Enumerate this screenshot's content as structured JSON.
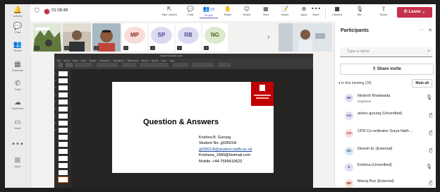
{
  "rail": [
    {
      "icon": "activity-icon",
      "glyph": "🔔",
      "label": "Activity"
    },
    {
      "icon": "chat-icon",
      "glyph": "💬",
      "label": "Chat"
    },
    {
      "icon": "teams-icon",
      "glyph": "👥",
      "label": "Teams"
    },
    {
      "icon": "calendar-icon",
      "glyph": "▦",
      "label": "Calendar"
    },
    {
      "icon": "calls-icon",
      "glyph": "✆",
      "label": "Calls"
    },
    {
      "icon": "onedrive-icon",
      "glyph": "☁",
      "label": "OneDrive"
    },
    {
      "icon": "meet-icon",
      "glyph": "▭",
      "label": "Meet"
    },
    {
      "icon": "more-icon",
      "glyph": "•••",
      "label": ""
    },
    {
      "icon": "apps-icon",
      "glyph": "⊞",
      "label": "Apps"
    }
  ],
  "meeting": {
    "timer": "01:08:48",
    "buttons": [
      {
        "name": "take-control",
        "icon": "⇱",
        "label": "Take control"
      },
      {
        "name": "chat",
        "icon": "💬",
        "label": "Chat"
      },
      {
        "name": "people",
        "icon": "👥",
        "label": "People",
        "count": "18"
      },
      {
        "name": "raise",
        "icon": "✋",
        "label": "Raise"
      },
      {
        "name": "react",
        "icon": "☺",
        "label": "React"
      },
      {
        "name": "view",
        "icon": "▦",
        "label": "View"
      },
      {
        "name": "notes",
        "icon": "📝",
        "label": "Notes"
      },
      {
        "name": "apps",
        "icon": "⊕",
        "label": "Apps"
      },
      {
        "name": "more",
        "icon": "•••",
        "label": "More"
      },
      {
        "name": "camera",
        "icon": "■",
        "label": "Camera"
      },
      {
        "name": "mic",
        "icon": "🎙",
        "label": "Mic"
      },
      {
        "name": "share",
        "icon": "⇧",
        "label": "Share"
      }
    ],
    "leave_label": "Leave"
  },
  "strip": {
    "avatars": [
      {
        "initials": "MP",
        "bg": "#f9dcd7",
        "fg": "#8e2b1f"
      },
      {
        "initials": "SP",
        "bg": "#dcd9f2",
        "fg": "#4f4596"
      },
      {
        "initials": "RB",
        "bg": "#dcdbf3",
        "fg": "#4e4b8f"
      },
      {
        "initials": "NG",
        "bg": "#dde8cf",
        "fg": "#4b6b1e"
      }
    ]
  },
  "slide": {
    "window_title": "Nepal Presentation.pptx",
    "ribbon_tabs": [
      "File",
      "Home",
      "Insert",
      "Draw",
      "Design",
      "Transitions",
      "Animations",
      "Slide Show",
      "Record",
      "Review",
      "View",
      "Help"
    ],
    "title": "Question & Answers",
    "lines": [
      {
        "text": "Krishna B. Gurung",
        "link": false
      },
      {
        "text": "Student No: g035014l",
        "link": false
      },
      {
        "text": "g035014l@student.staffs.ac.uk",
        "link": true
      },
      {
        "text": "Krishana_1840@Hotmail.com",
        "link": false
      },
      {
        "text": "Mobile: +44-7596410623",
        "link": false
      }
    ]
  },
  "panel": {
    "title": "Participants",
    "search_placeholder": "Type a name",
    "share_invite": "Share invite",
    "in_meeting": "In this meeting (18)",
    "mute_all": "Mute all",
    "participants": [
      {
        "initials": "NK",
        "name": "Nirdesh Khatiwada",
        "role": "Organizer",
        "bg": "#dfe0f5",
        "fg": "#444791",
        "mic": "on"
      },
      {
        "initials": "AG",
        "name": "ashes gurung (Unverified)",
        "role": "",
        "bg": "#dfe0f5",
        "fg": "#444791",
        "mic": "off"
      },
      {
        "initials": "CG",
        "name": "CPD Co-ordinator Surya Nath ...",
        "role": "",
        "bg": "#fbdcdc",
        "fg": "#a4262c",
        "mic": "off"
      },
      {
        "initials": "DK",
        "name": "Dinesh kc (External)",
        "role": "",
        "bg": "#d6e4f0",
        "fg": "#235a8a",
        "mic": "off"
      },
      {
        "initials": "K",
        "name": "Krishna (Unverified)",
        "role": "",
        "bg": "#dfe0f5",
        "fg": "#444791",
        "mic": "on"
      },
      {
        "initials": "MP",
        "name": "Manoj Pun (External)",
        "role": "",
        "bg": "#fbdcd3",
        "fg": "#8e2b1f",
        "mic": "off"
      }
    ]
  }
}
